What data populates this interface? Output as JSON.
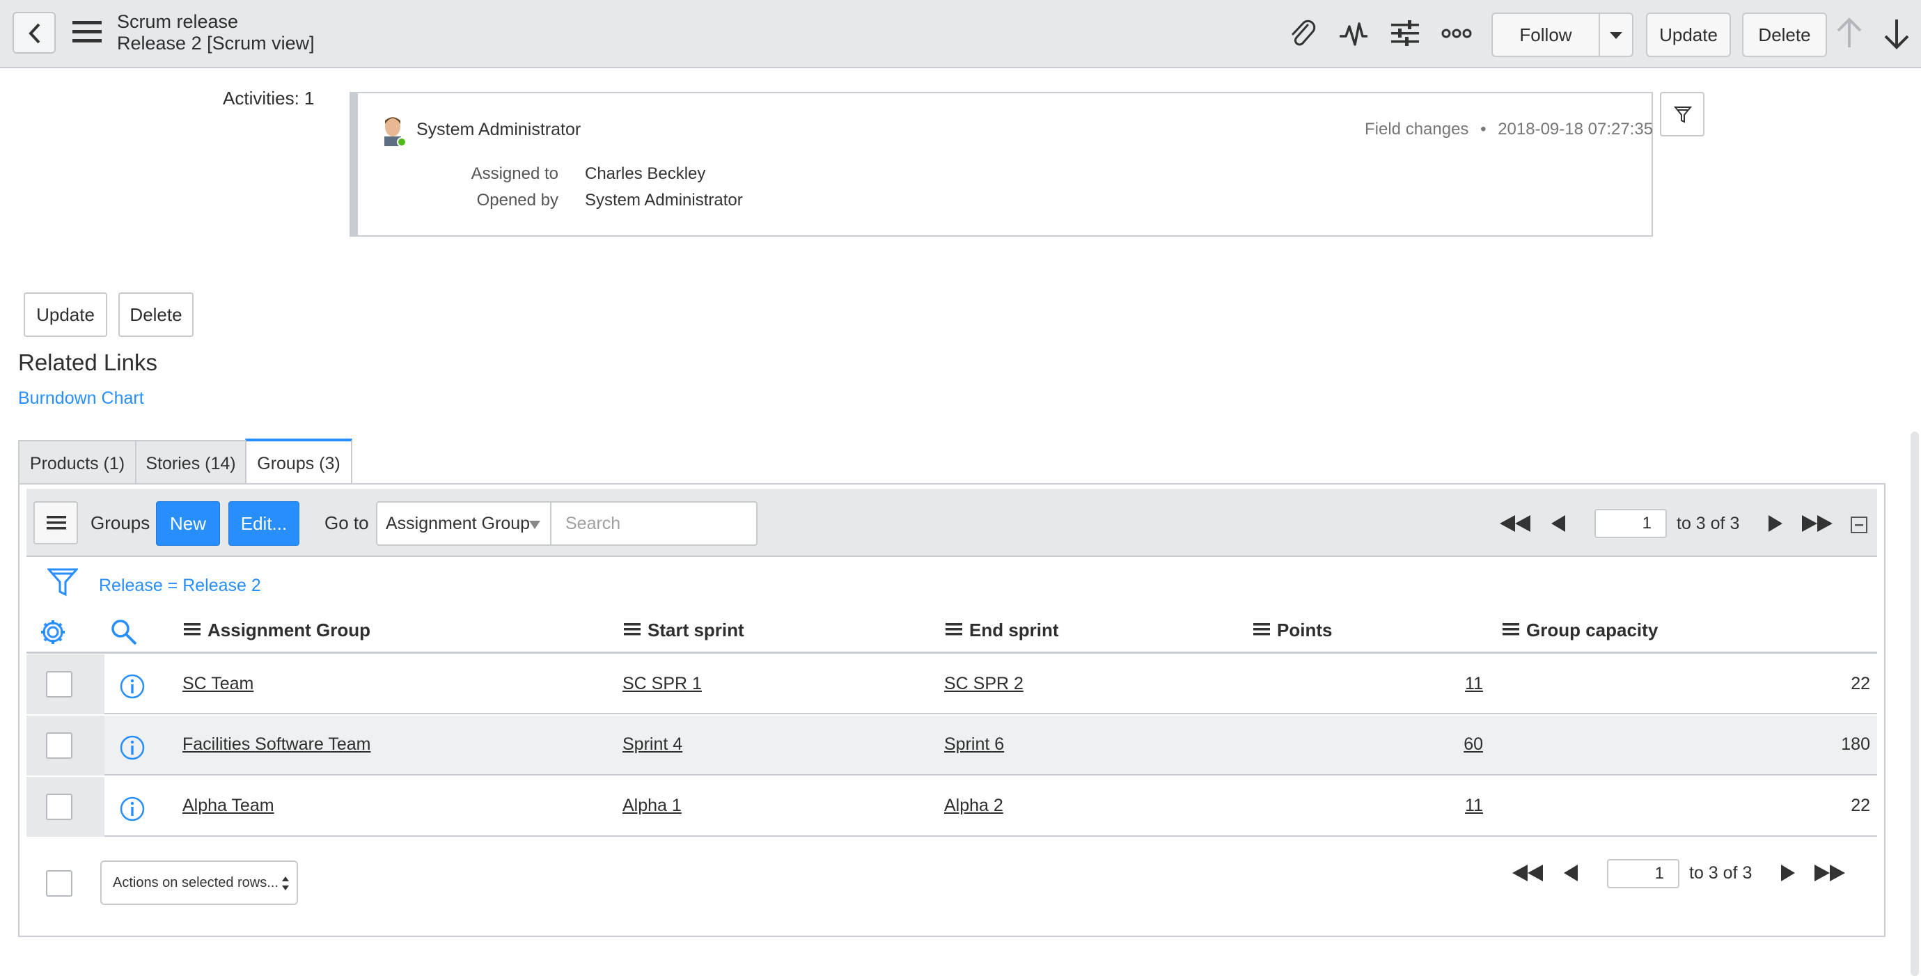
{
  "header": {
    "title": "Scrum release",
    "subtitle": "Release 2 [Scrum view]",
    "follow_label": "Follow",
    "update_label": "Update",
    "delete_label": "Delete"
  },
  "activity": {
    "count_label": "Activities: 1",
    "user": "System Administrator",
    "type": "Field changes",
    "separator": "•",
    "timestamp": "2018-09-18 07:27:35",
    "fields": [
      {
        "label": "Assigned to",
        "value": "Charles Beckley"
      },
      {
        "label": "Opened by",
        "value": "System Administrator"
      }
    ]
  },
  "form_buttons": {
    "update_label": "Update",
    "delete_label": "Delete"
  },
  "related_links": {
    "title": "Related Links",
    "burndown": "Burndown Chart"
  },
  "tabs": [
    {
      "label": "Products (1)",
      "active": false
    },
    {
      "label": "Stories (14)",
      "active": false
    },
    {
      "label": "Groups (3)",
      "active": true
    }
  ],
  "list": {
    "title": "Groups",
    "new_label": "New",
    "edit_label": "Edit...",
    "goto_label": "Go to",
    "goto_field": "Assignment Group",
    "search_placeholder": "Search",
    "page": "1",
    "range_text": "to 3 of 3",
    "filter_text": "Release = Release 2",
    "columns": [
      "Assignment Group",
      "Start sprint",
      "End sprint",
      "Points",
      "Group capacity"
    ],
    "rows": [
      {
        "group": "SC Team",
        "start": "SC SPR 1",
        "end": "SC SPR 2",
        "points": "11",
        "capacity": "22"
      },
      {
        "group": "Facilities Software Team",
        "start": "Sprint 4",
        "end": "Sprint 6",
        "points": "60",
        "capacity": "180"
      },
      {
        "group": "Alpha Team",
        "start": "Alpha 1",
        "end": "Alpha 2",
        "points": "11",
        "capacity": "22"
      }
    ],
    "actions_label": "Actions on selected rows...",
    "bottom_page": "1",
    "bottom_range_text": "to 3 of 3"
  },
  "colors": {
    "accent": "#278efc",
    "bar": "#e6e8ea",
    "border": "#c9cdd1"
  }
}
